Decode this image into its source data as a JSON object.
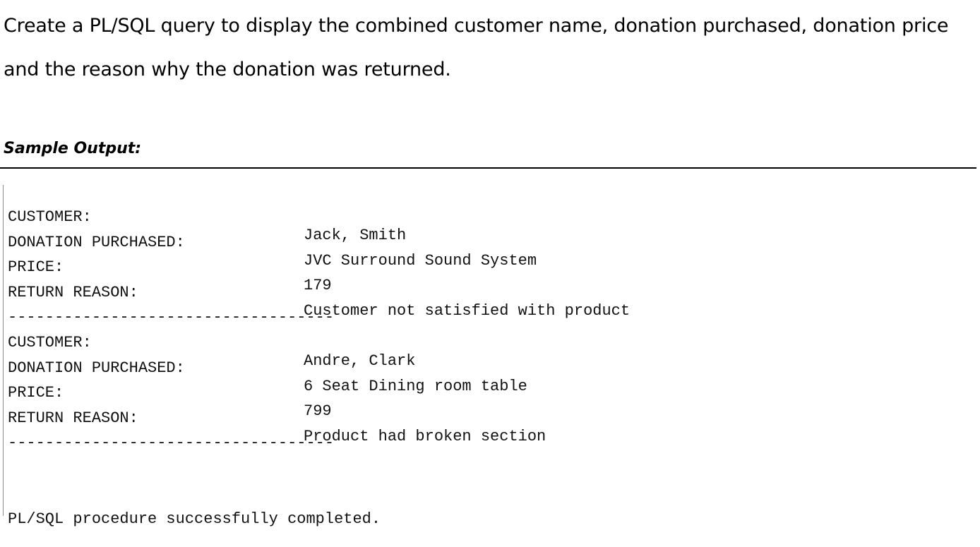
{
  "question": {
    "line1": "Create a PL/SQL query to display the combined customer name, donation purchased, donation price",
    "line2": "and the reason why the donation was returned."
  },
  "sample_label": "Sample Output:",
  "records": [
    {
      "customer_label": "CUSTOMER:",
      "customer_value": "Jack, Smith",
      "donation_label": "DONATION PURCHASED:",
      "donation_value": "JVC Surround Sound System",
      "price_label": "PRICE:",
      "price_value": "179",
      "reason_label": "RETURN REASON:",
      "reason_value": "Customer not satisfied with product",
      "separator": "-----------------------------------"
    },
    {
      "customer_label": "CUSTOMER:",
      "customer_value": "Andre, Clark",
      "donation_label": "DONATION PURCHASED:",
      "donation_value": "6 Seat Dining room table",
      "price_label": "PRICE:",
      "price_value": "799",
      "reason_label": "RETURN REASON:",
      "reason_value": "Product had broken section",
      "separator": "-----------------------------------"
    }
  ],
  "completion_message": "PL/SQL procedure successfully completed."
}
